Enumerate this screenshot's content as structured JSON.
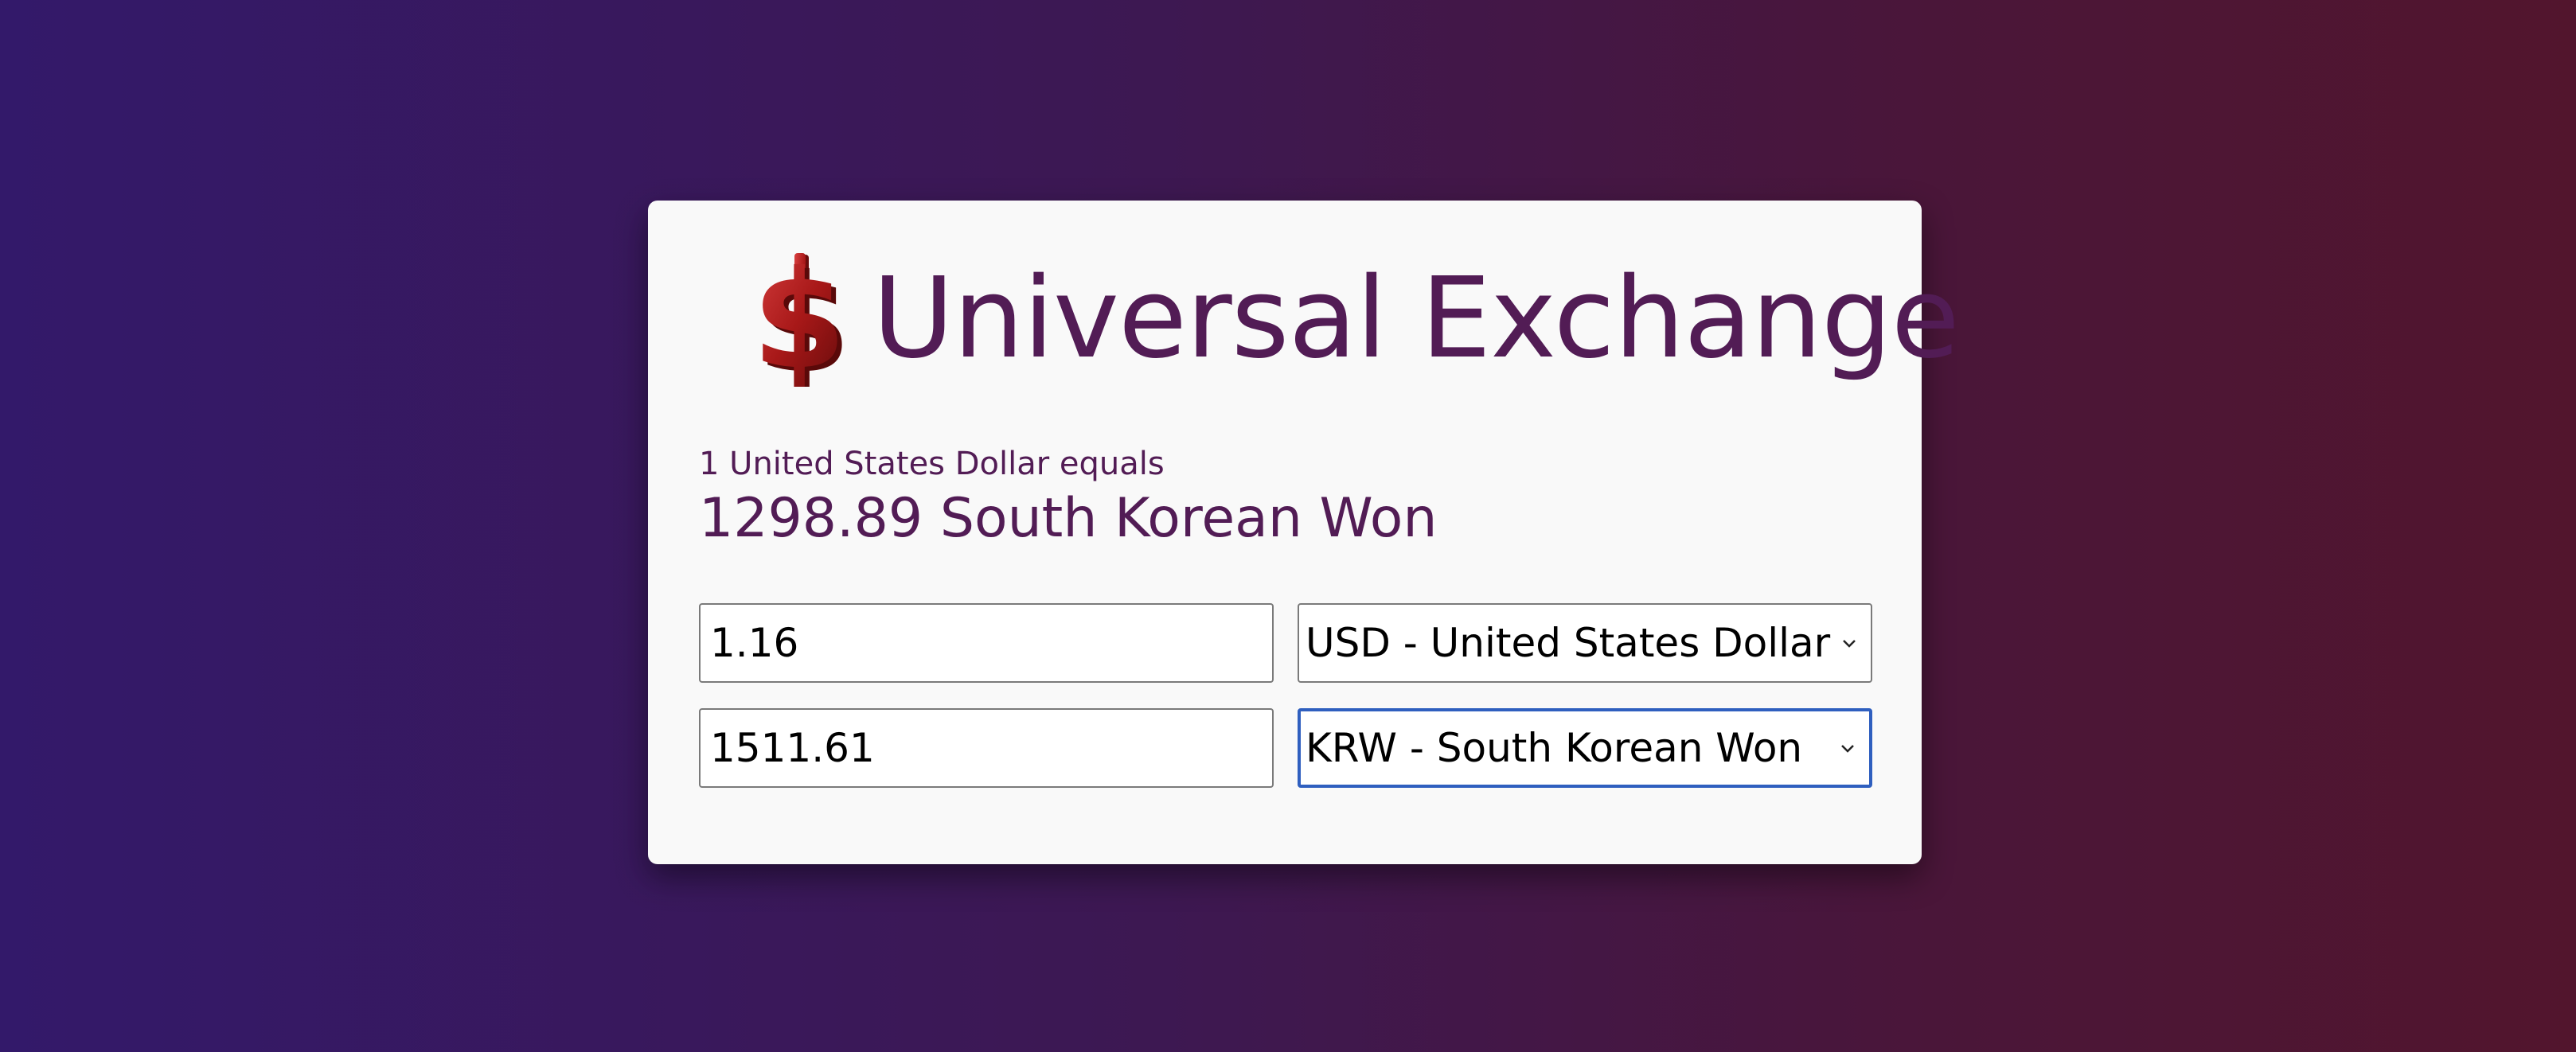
{
  "header": {
    "logo_icon": "dollar-sign-icon",
    "title": "Universal Exchange"
  },
  "rate": {
    "caption": "1 United States Dollar equals",
    "result": "1298.89 South Korean Won"
  },
  "converter": {
    "from": {
      "amount": "1.16",
      "currency": "USD - United States Dollar"
    },
    "to": {
      "amount": "1511.61",
      "currency": "KRW - South Korean Won"
    }
  },
  "colors": {
    "title": "#521c55",
    "logo": "#a01a1a",
    "focus_border": "#2f5fbf"
  }
}
